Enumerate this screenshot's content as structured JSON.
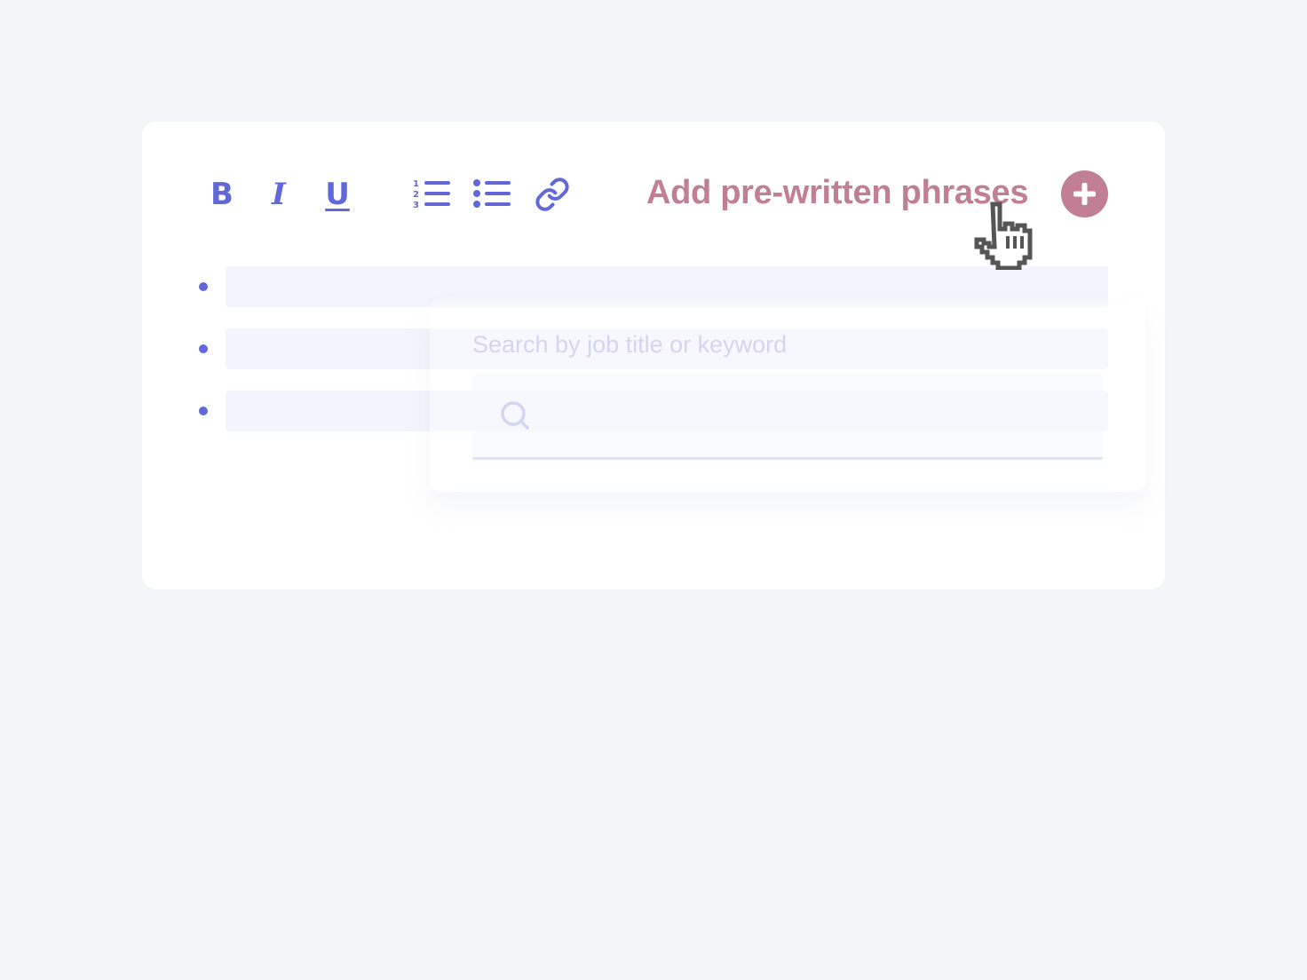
{
  "colors": {
    "page_background": "#f4f5f9",
    "card_background": "#ffffff",
    "toolbar_accent": "#6268d8",
    "phrases_accent": "#c07f95",
    "bullet_line": "#f3f4fd"
  },
  "toolbar": {
    "bold_label": "B",
    "italic_label": "I",
    "underline_label": "U",
    "numbered_list_icon": "numbered-list-icon",
    "bulleted_list_icon": "bulleted-list-icon",
    "link_icon": "link-icon"
  },
  "phrases": {
    "label": "Add pre-written phrases",
    "button_icon": "plus-icon"
  },
  "editor": {
    "bullets": [
      "",
      "",
      ""
    ]
  },
  "popup": {
    "label": "Search by job title or keyword",
    "search_value": "",
    "search_icon": "search-icon"
  },
  "cursor": {
    "icon": "hand-pointer-cursor-icon"
  }
}
